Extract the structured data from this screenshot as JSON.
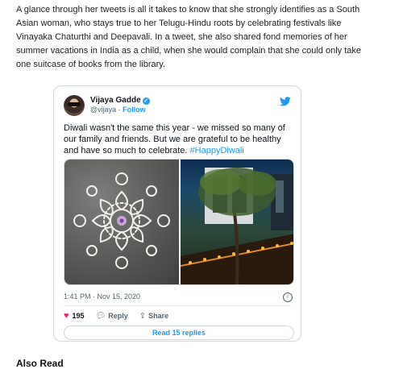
{
  "article": {
    "paragraph": "A glance through her tweets is all it takes to know that she strongly identifies as a South Asian woman, who stays true to her Telugu-Hindu roots by celebrating festivals like Vinayaka Chaturthi and Deepavali. In a tweet, she also shared fond memories of her summer vacations in India as a child, when she would complain that she could only take one suitcase of books from the library.",
    "also_read": "Also Read"
  },
  "tweet": {
    "author_name": "Vijaya Gadde",
    "handle": "@vijaya",
    "separator": " · ",
    "follow_label": "Follow",
    "text": "Diwali wasn't the same this year - we missed so many of our family and friends. But we are grateful to be healthy and have so much to celebrate. ",
    "hashtag": "#HappyDiwali",
    "timestamp": "1:41 PM · Nov 15, 2020",
    "likes": "195",
    "reply_label": "Reply",
    "share_label": "Share",
    "read_replies_label": "Read 15 replies",
    "icons": {
      "verified": "verified-badge-icon",
      "twitter": "twitter-bird-icon",
      "info": "info-icon",
      "like": "heart-icon",
      "reply": "reply-icon",
      "share": "share-icon"
    },
    "colors": {
      "accent": "#1d9bf0",
      "like": "#f91880",
      "text": "#0f1419",
      "muted": "#536471"
    }
  }
}
